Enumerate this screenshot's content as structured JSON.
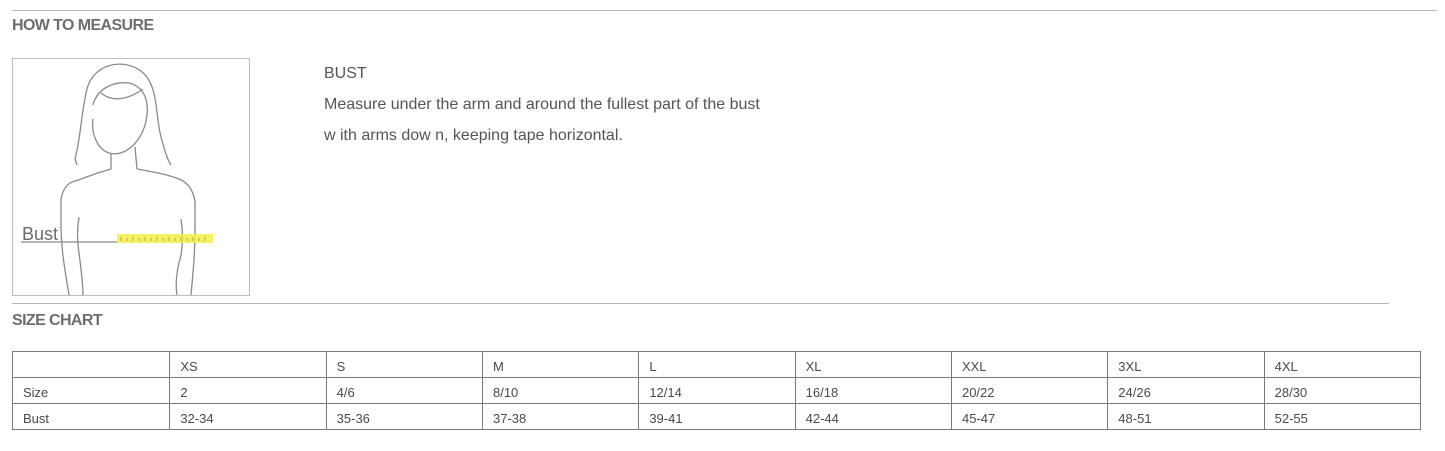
{
  "how_to_measure": {
    "heading": "HOW TO MEASURE",
    "figure_label": "Bust",
    "bust_title": "BUST",
    "bust_lines": [
      "Measure under the arm and around the fullest part of the bust",
      "w ith arms dow n, keeping tape horizontal."
    ],
    "tape_color": "#f2ee4a"
  },
  "size_chart": {
    "heading": "SIZE CHART",
    "headers": [
      "",
      "XS",
      "S",
      "M",
      "L",
      "XL",
      "XXL",
      "3XL",
      "4XL"
    ],
    "rows": [
      {
        "label": "Size",
        "values": [
          "2",
          "4/6",
          "8/10",
          "12/14",
          "16/18",
          "20/22",
          "24/26",
          "28/30"
        ]
      },
      {
        "label": "Bust",
        "values": [
          "32-34",
          "35-36",
          "37-38",
          "39-41",
          "42-44",
          "45-47",
          "48-51",
          "52-55"
        ]
      }
    ]
  }
}
